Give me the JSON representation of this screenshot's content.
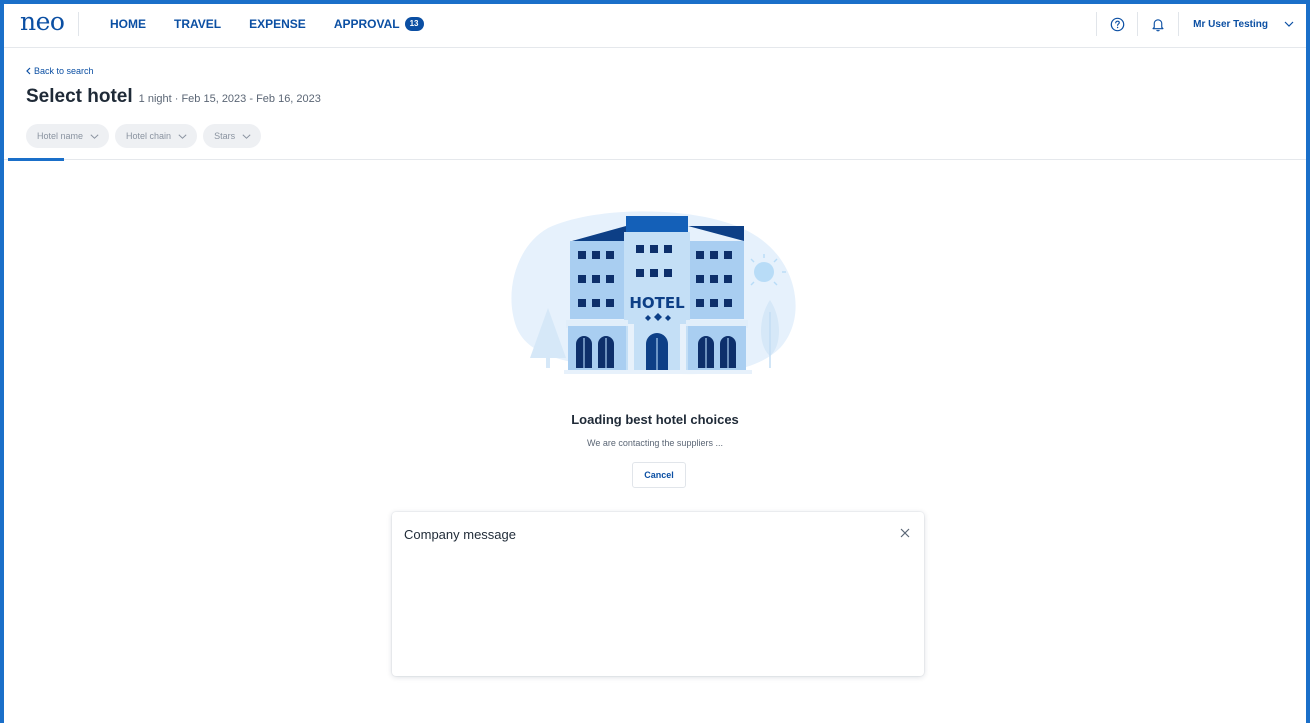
{
  "app": {
    "logo": "neo",
    "nav": [
      {
        "label": "HOME"
      },
      {
        "label": "TRAVEL"
      },
      {
        "label": "EXPENSE"
      },
      {
        "label": "APPROVAL",
        "badge": "13"
      }
    ],
    "user_name": "Mr User Testing",
    "icons": [
      "help-icon",
      "bell-icon",
      "chevron-down-icon"
    ]
  },
  "header": {
    "back_label": "Back to search",
    "title": "Select hotel",
    "subtitle": "1 night · Feb 15, 2023 - Feb 16, 2023"
  },
  "filters": [
    {
      "label": "Hotel name"
    },
    {
      "label": "Hotel chain"
    },
    {
      "label": "Stars"
    }
  ],
  "loading": {
    "illustration_sign": "HOTEL",
    "title": "Loading best hotel choices",
    "subtitle": "We are contacting the suppliers ...",
    "cancel_label": "Cancel"
  },
  "modal": {
    "title": "Company message"
  },
  "colors": {
    "brand": "#0b4fa3",
    "accent": "#1a6fc9",
    "chip_bg": "#eef0f3"
  }
}
